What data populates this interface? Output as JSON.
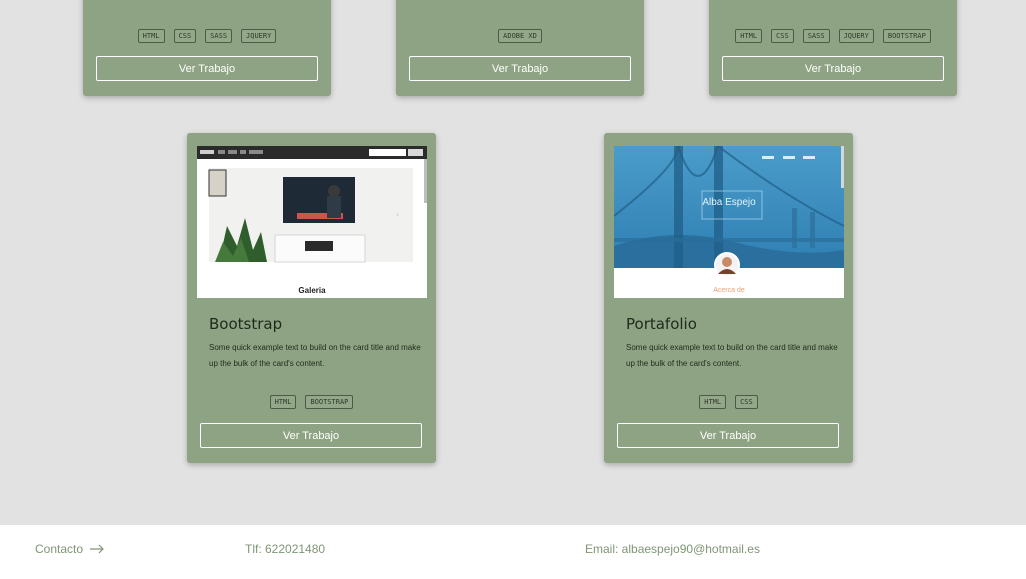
{
  "top_cards": [
    {
      "tags": [
        "HTML",
        "CSS",
        "SASS",
        "JQUERY"
      ],
      "button": "Ver Trabajo"
    },
    {
      "tags": [
        "ADOBE XD"
      ],
      "button": "Ver Trabajo"
    },
    {
      "tags": [
        "HTML",
        "CSS",
        "SASS",
        "JQUERY",
        "BOOTSTRAP"
      ],
      "button": "Ver Trabajo"
    }
  ],
  "cards": [
    {
      "title": "Bootstrap",
      "text": "Some quick example text to build on the card title and make up the bulk of the card's content.",
      "tags": [
        "HTML",
        "BOOTSTRAP"
      ],
      "button": "Ver Trabajo",
      "thumb": {
        "caption": "Galeria"
      }
    },
    {
      "title": "Portafolio",
      "text": "Some quick example text to build on the card title and make up the bulk of the card's content.",
      "tags": [
        "HTML",
        "CSS"
      ],
      "button": "Ver Trabajo",
      "thumb": {
        "name": "Alba Espejo",
        "caption": "Acerca de"
      }
    }
  ],
  "footer": {
    "contact": "Contacto",
    "phone": "Tlf: 622021480",
    "email": "Email: albaespejo90@hotmail.es"
  },
  "colors": {
    "card": "#8ea383",
    "background": "#e2e2e2",
    "footer_text": "#7f9575"
  }
}
